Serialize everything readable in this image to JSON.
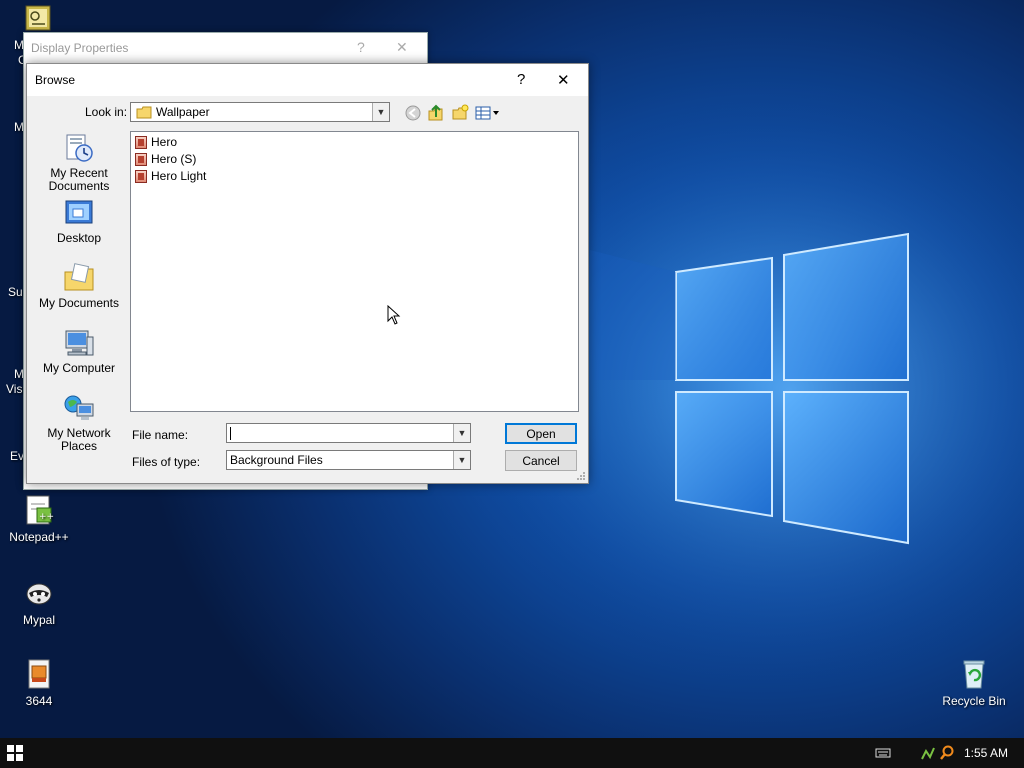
{
  "desktop": {
    "icons": [
      {
        "label": "Notepad++",
        "icon": "notepad-plus-icon"
      },
      {
        "label": "Mypal",
        "icon": "raccoon-browser-icon"
      },
      {
        "label": "3644",
        "icon": "archive-file-icon"
      },
      {
        "label": "Recycle Bin",
        "icon": "recycle-bin-icon"
      }
    ],
    "partial_labels": [
      "M",
      "C",
      "M",
      "Sup",
      "M",
      "Visu",
      "Ev"
    ]
  },
  "display_properties": {
    "title": "Display Properties",
    "help_glyph": "?",
    "close_glyph": "✕"
  },
  "browse": {
    "title": "Browse",
    "help_glyph": "?",
    "close_glyph": "✕",
    "look_in_label": "Look in:",
    "look_in_value": "Wallpaper",
    "places": [
      {
        "label_line1": "My Recent",
        "label_line2": "Documents",
        "icon": "recent-documents-icon"
      },
      {
        "label_line1": "Desktop",
        "label_line2": "",
        "icon": "desktop-icon"
      },
      {
        "label_line1": "My Documents",
        "label_line2": "",
        "icon": "my-documents-icon"
      },
      {
        "label_line1": "My Computer",
        "label_line2": "",
        "icon": "my-computer-icon"
      },
      {
        "label_line1": "My Network",
        "label_line2": "Places",
        "icon": "network-places-icon"
      }
    ],
    "files": [
      {
        "name": "Hero"
      },
      {
        "name": "Hero (S)"
      },
      {
        "name": "Hero Light"
      }
    ],
    "file_name_label": "File name:",
    "file_name_value": "",
    "files_of_type_label": "Files of type:",
    "files_of_type_value": "Background Files",
    "open_label": "Open",
    "cancel_label": "Cancel"
  },
  "taskbar": {
    "clock": "1:55 AM"
  },
  "colors": {
    "accent": "#0078d7",
    "taskbar": "#101010"
  }
}
